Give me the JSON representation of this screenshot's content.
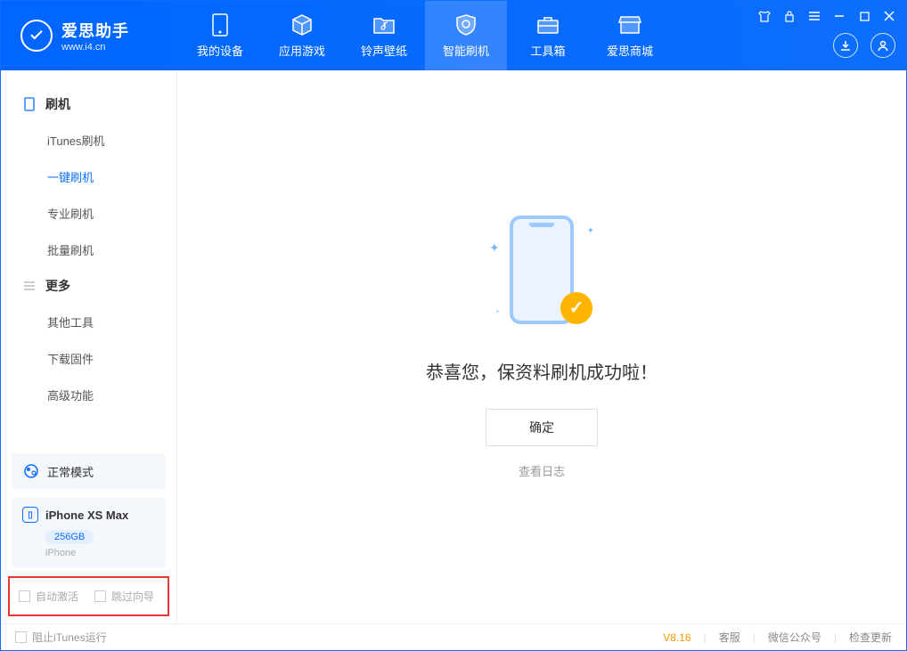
{
  "app": {
    "title": "爱思助手",
    "url": "www.i4.cn"
  },
  "tabs": {
    "device": "我的设备",
    "apps": "应用游戏",
    "ringtones": "铃声壁纸",
    "flash": "智能刷机",
    "toolbox": "工具箱",
    "store": "爱思商城"
  },
  "sidebar": {
    "flash_header": "刷机",
    "itunes_flash": "iTunes刷机",
    "oneclick_flash": "一键刷机",
    "pro_flash": "专业刷机",
    "batch_flash": "批量刷机",
    "more_header": "更多",
    "other_tools": "其他工具",
    "download_fw": "下载固件",
    "advanced": "高级功能"
  },
  "mode_panel": "正常模式",
  "device": {
    "name": "iPhone XS Max",
    "storage": "256GB",
    "type": "iPhone"
  },
  "options": {
    "auto_activate": "自动激活",
    "skip_wizard": "跳过向导"
  },
  "main": {
    "success_text": "恭喜您，保资料刷机成功啦！",
    "ok_button": "确定",
    "view_log": "查看日志"
  },
  "footer": {
    "block_itunes": "阻止iTunes运行",
    "version": "V8.16",
    "support": "客服",
    "wechat": "微信公众号",
    "update": "检查更新"
  }
}
